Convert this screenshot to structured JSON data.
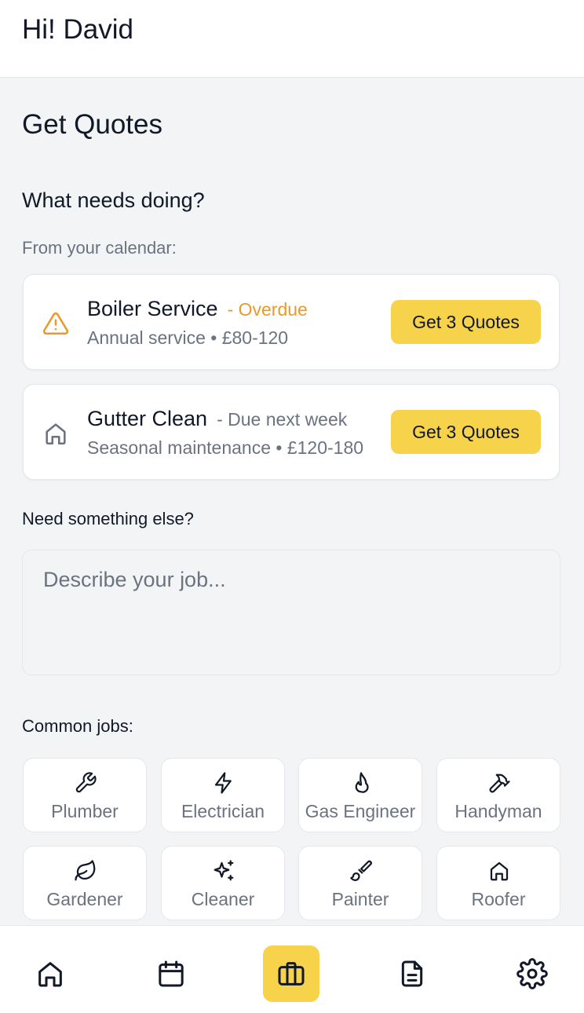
{
  "header": {
    "greeting": "Hi! David"
  },
  "page_title": "Get Quotes",
  "section_title": "What needs doing?",
  "calendar_label": "From your calendar:",
  "tasks": [
    {
      "title": "Boiler Service",
      "status": "- Overdue",
      "status_color": "#e99a2a",
      "subtitle": "Annual service • £80-120",
      "icon": "warning-icon",
      "button": "Get 3 Quotes"
    },
    {
      "title": "Gutter Clean",
      "status": "- Due next week",
      "status_color": "#6b7280",
      "subtitle": "Seasonal maintenance • £120-180",
      "icon": "home-icon",
      "button": "Get 3 Quotes"
    }
  ],
  "else_label": "Need something else?",
  "job_input": {
    "placeholder": "Describe your job...",
    "value": ""
  },
  "common_label": "Common jobs:",
  "common_jobs": [
    {
      "label": "Plumber",
      "icon": "wrench-icon"
    },
    {
      "label": "Electrician",
      "icon": "lightning-icon"
    },
    {
      "label": "Gas Engineer",
      "icon": "flame-icon"
    },
    {
      "label": "Handyman",
      "icon": "hammer-icon"
    },
    {
      "label": "Gardener",
      "icon": "leaf-icon"
    },
    {
      "label": "Cleaner",
      "icon": "sparkles-icon"
    },
    {
      "label": "Painter",
      "icon": "paintbrush-icon"
    },
    {
      "label": "Roofer",
      "icon": "home-icon"
    }
  ],
  "nav": [
    {
      "icon": "home-icon",
      "active": false
    },
    {
      "icon": "calendar-icon",
      "active": false
    },
    {
      "icon": "briefcase-icon",
      "active": true
    },
    {
      "icon": "document-icon",
      "active": false
    },
    {
      "icon": "gear-icon",
      "active": false
    }
  ],
  "colors": {
    "accent": "#f6d34a",
    "warning": "#e99a2a",
    "muted_text": "#6b7280",
    "background": "#f3f4f6"
  }
}
